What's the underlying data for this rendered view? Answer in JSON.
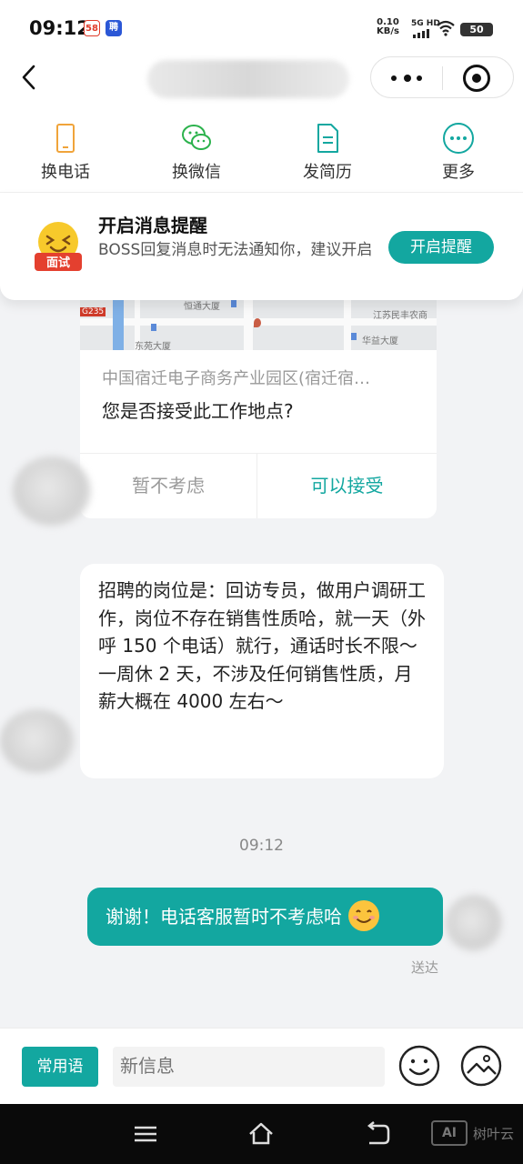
{
  "status_bar": {
    "time": "09:12",
    "app_icon_1": "58",
    "app_icon_2": "聘",
    "net_speed_value": "0.10",
    "net_speed_unit": "KB/s",
    "network": "5G HD",
    "battery": "50"
  },
  "nav": {
    "back_icon": "chevron-left-icon",
    "more_icon": "more-dots-icon",
    "close_icon": "target-close-icon"
  },
  "actions": [
    {
      "label": "换电话",
      "icon": "phone-icon",
      "color": "#f0a43a"
    },
    {
      "label": "换微信",
      "icon": "wechat-icon",
      "color": "#2bb24c"
    },
    {
      "label": "发简历",
      "icon": "resume-icon",
      "color": "#13a7a0"
    },
    {
      "label": "更多",
      "icon": "more-circle-icon",
      "color": "#13a7a0"
    }
  ],
  "notice": {
    "title": "开启消息提醒",
    "description": "BOSS回复消息时无法通知你，建议开启",
    "button": "开启提醒",
    "badge": "面试"
  },
  "location_card": {
    "map_labels": [
      "恒通大厦",
      "东苑大厦",
      "江苏民丰农商",
      "华益大厦",
      "G235"
    ],
    "address": "中国宿迁电子商务产业园区(宿迁宿…",
    "question": "您是否接受此工作地点?",
    "reject_label": "暂不考虑",
    "accept_label": "可以接受"
  },
  "messages": {
    "received": "招聘的岗位是：回访专员，做用户调研工作，岗位不存在销售性质哈，就一天（外呼 150 个电话）就行，通话时长不限～ 一周休 2 天，不涉及任何销售性质，月薪大概在 4000 左右～",
    "timestamp": "09:12",
    "sent": "谢谢！电话客服暂时不考虑哈",
    "sent_status": "送达"
  },
  "input_bar": {
    "phrases_button": "常用语",
    "placeholder": "新信息"
  },
  "watermark": {
    "logo": "AI",
    "text": "树叶云"
  },
  "colors": {
    "accent": "#13a7a0"
  }
}
